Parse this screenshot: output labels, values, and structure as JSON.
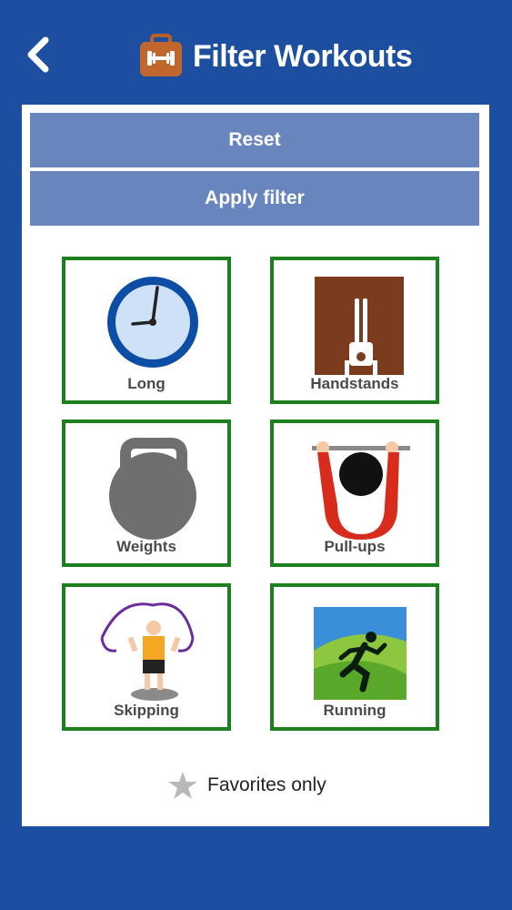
{
  "header": {
    "title": "Filter Workouts",
    "back_icon": "chevron-left-icon",
    "title_icon": "dumbbell-briefcase-icon"
  },
  "actions": {
    "reset_label": "Reset",
    "apply_label": "Apply filter"
  },
  "filters": [
    {
      "label": "Long",
      "icon": "clock-icon"
    },
    {
      "label": "Handstands",
      "icon": "handstand-icon"
    },
    {
      "label": "Weights",
      "icon": "kettlebell-icon"
    },
    {
      "label": "Pull-ups",
      "icon": "pull-up-icon"
    },
    {
      "label": "Skipping",
      "icon": "jump-rope-icon"
    },
    {
      "label": "Running",
      "icon": "runner-icon"
    }
  ],
  "favorites": {
    "label": "Favorites only",
    "icon": "star-icon"
  },
  "colors": {
    "background": "#1d4fa0",
    "button": "#6886bd",
    "tile_border": "#1d7f1d"
  }
}
